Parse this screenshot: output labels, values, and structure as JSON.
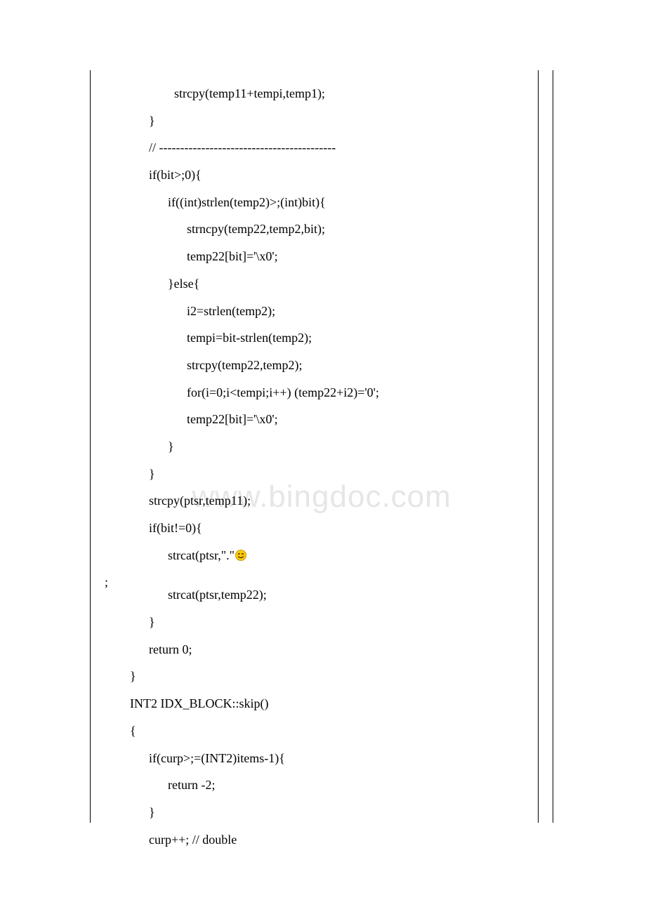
{
  "watermark": "www.bingdoc.com",
  "semicolon_outside": ";",
  "code_lines": [
    "                      strcpy(temp11+tempi,temp1);",
    "              }",
    "              // ------------------------------------------",
    "              if(bit>;0){",
    "                    if((int)strlen(temp2)>;(int)bit){",
    "                          strncpy(temp22,temp2,bit);",
    "                          temp22[bit]='\\x0';",
    "                    }else{",
    "                          i2=strlen(temp2);",
    "                          tempi=bit-strlen(temp2);",
    "                          strcpy(temp22,temp2);",
    "                          for(i=0;i<tempi;i++) (temp22+i2)='0';",
    "                          temp22[bit]='\\x0';",
    "                    }",
    "              }",
    "              strcpy(ptsr,temp11);",
    "              if(bit!=0){",
    "                    strcat(ptsr,\".\"",
    "",
    "                    strcat(ptsr,temp22);",
    "              }",
    "              return 0;",
    "        }",
    "        INT2 IDX_BLOCK::skip()",
    "        {",
    "              if(curp>;=(INT2)items-1){",
    "                    return -2;",
    "              }",
    "              curp++; // double"
  ],
  "emoji_line_index": 17
}
